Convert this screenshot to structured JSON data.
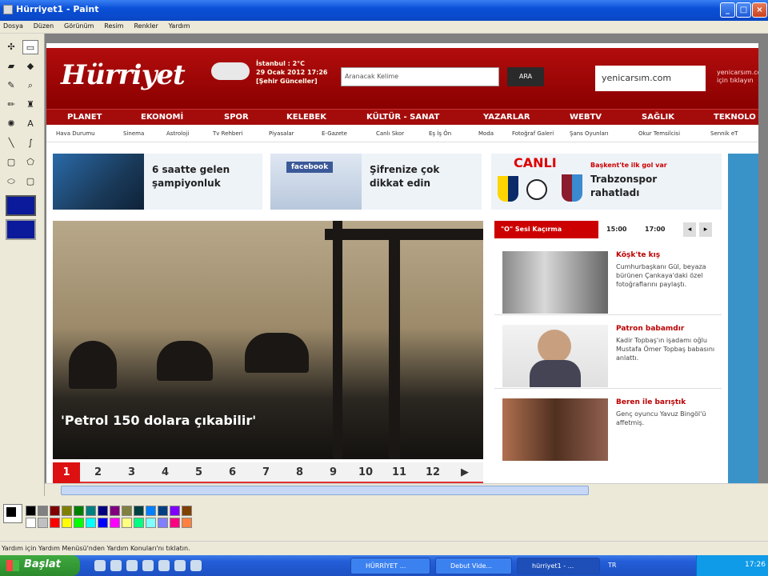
{
  "window": {
    "title": "Hürriyet1 - Paint"
  },
  "menu": [
    "Dosya",
    "Düzen",
    "Görünüm",
    "Resim",
    "Renkler",
    "Yardım"
  ],
  "site": {
    "logo": "Hürriyet",
    "weather": {
      "line1": "İstanbul : 2°C",
      "line2": "29 Ocak 2012 17:26",
      "line3": "[Şehir Günceller]"
    },
    "search_placeholder": "Aranacak Kelime",
    "search_button": "ARA",
    "ad_text": "yenicarsım.com",
    "ad_side": "yenicarsım.com\niçin tıklayın",
    "nav": [
      "PLANET",
      "EKONOMİ",
      "SPOR",
      "KELEBEK",
      "KÜLTÜR - SANAT",
      "YAZARLAR",
      "WEBTV",
      "SAĞLIK",
      "TEKNOLO"
    ],
    "subnav": [
      "Hava Durumu",
      "Sinema",
      "Astroloji",
      "Tv Rehberi",
      "Piyasalar",
      "E-Gazete",
      "Canlı Skor",
      "Eş İş Ön",
      "Moda",
      "Fotoğraf Galeri",
      "Şans Oyunları",
      "Okur Temsilcisi",
      "Sennik eT"
    ],
    "promos": [
      {
        "text": "6 saatte gelen\nşampiyonluk"
      },
      {
        "text": "Şifrenize çok\ndikkat edin",
        "img_label": "facebook"
      },
      {
        "canli": "CANLI",
        "subhead": "Başkent'te ilk gol var",
        "text": "Trabzonspor\nrahatladı"
      }
    ],
    "hero": {
      "title": "'Petrol 150 dolara çıkabilir'",
      "pages": [
        "1",
        "2",
        "3",
        "4",
        "5",
        "6",
        "7",
        "8",
        "9",
        "10",
        "11",
        "12",
        "▶"
      ]
    },
    "tv": {
      "tag": "\"O\" Sesi Kaçırma",
      "times": [
        "15:00",
        "17:00"
      ]
    },
    "news": [
      {
        "head": "Köşk'te kış",
        "body": "Cumhurbaşkanı Gül, beyaza bürünen Çankaya'daki özel fotoğraflarını paylaştı."
      },
      {
        "head": "Patron babamdır",
        "body": "Kadir Topbaş'ın işadamı oğlu Mustafa Ömer Topbaş babasını anlattı."
      },
      {
        "head": "Beren ile barıştık",
        "body": "Genç oyuncu Yavuz Bingöl'ü affetmiş."
      }
    ]
  },
  "status": "Yardım için Yardım Menüsü'nden Yardım Konuları'nı tıklatın.",
  "taskbar": {
    "start": "Başlat",
    "tasks": [
      "HÜRRİYET ...",
      "Debut Vide...",
      "hürriyet1 - ..."
    ],
    "lang": "TR",
    "clock": "17:26"
  },
  "palette_colors": [
    "#000000",
    "#808080",
    "#800000",
    "#808000",
    "#008000",
    "#008080",
    "#000080",
    "#800080",
    "#808040",
    "#004040",
    "#0080ff",
    "#004080",
    "#8000ff",
    "#804000",
    "#ffffff",
    "#c0c0c0",
    "#ff0000",
    "#ffff00",
    "#00ff00",
    "#00ffff",
    "#0000ff",
    "#ff00ff",
    "#ffff80",
    "#00ff80",
    "#80ffff",
    "#8080ff",
    "#ff0080",
    "#ff8040"
  ]
}
